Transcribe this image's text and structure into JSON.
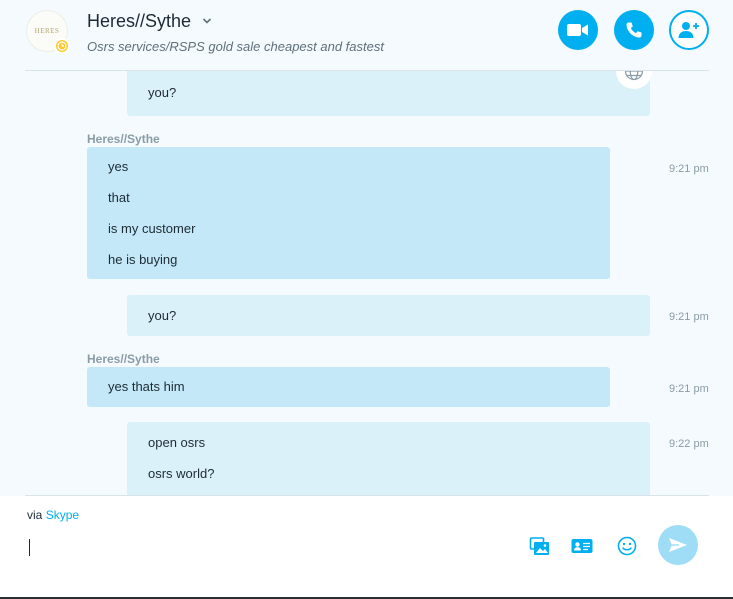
{
  "header": {
    "contact_name": "Heres//Sythe",
    "mood": "Osrs services/RSPS gold sale cheapest and fastest",
    "avatar_logo_text": "HERES",
    "icons": {
      "chevron": "chevron-down-icon",
      "video": "video-call-icon",
      "call": "phone-icon",
      "add": "add-person-icon",
      "away": "clock-icon"
    }
  },
  "messages": [
    {
      "direction": "out",
      "lines": [
        "you?"
      ],
      "time": ""
    },
    {
      "direction": "in",
      "sender": "Heres//Sythe",
      "lines": [
        "yes",
        "that",
        "is my customer",
        "he is buying"
      ],
      "time": "9:21 pm"
    },
    {
      "direction": "out",
      "lines": [
        "you?"
      ],
      "time": "9:21 pm"
    },
    {
      "direction": "in",
      "sender": "Heres//Sythe",
      "lines": [
        "yes thats him"
      ],
      "time": "9:21 pm"
    },
    {
      "direction": "out",
      "lines": [
        "open osrs",
        "osrs world?"
      ],
      "time": "9:22 pm"
    }
  ],
  "composer": {
    "via_prefix": "via",
    "via_link": "Skype",
    "input_value": "",
    "icons": [
      "media-icon",
      "contact-card-icon",
      "emoji-icon",
      "send-icon"
    ]
  },
  "colors": {
    "accent": "#00aff0",
    "bubble_out": "#dbf1fa",
    "bubble_in": "#c4e8f8",
    "away": "#ffc629"
  }
}
